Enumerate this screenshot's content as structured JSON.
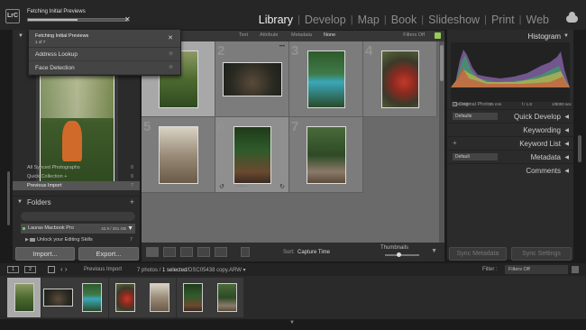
{
  "app": {
    "logo": "LrC"
  },
  "task": {
    "title": "Fetching Initial Previews",
    "progress": 0.5
  },
  "popup": {
    "title": "Fetching Initial Previews",
    "subtitle": "1 of 7",
    "items": [
      {
        "label": "Address Lookup"
      },
      {
        "label": "Face Detection"
      }
    ]
  },
  "modules": [
    "Library",
    "Develop",
    "Map",
    "Book",
    "Slideshow",
    "Print",
    "Web"
  ],
  "active_module": "Library",
  "filter_bar": {
    "text": "Text",
    "attribute": "Attribute",
    "metadata": "Metadata",
    "none": "None",
    "filters_off": "Filters Off"
  },
  "catalog": [
    {
      "label": "All Synced Photographs",
      "count": "0"
    },
    {
      "label": "Quick Collection +",
      "count": "0"
    },
    {
      "label": "Previous Import",
      "count": "7"
    }
  ],
  "folders": {
    "label": "Folders",
    "volume": {
      "name": "Lauras Macbook Pro",
      "size": "42.9 / 251 GB"
    },
    "folder": {
      "name": "Unlock your Editing Skills",
      "count": "7"
    }
  },
  "buttons": {
    "import": "Import...",
    "export": "Export...",
    "sync_metadata": "Sync Metadata",
    "sync_settings": "Sync Settings"
  },
  "grid": {
    "cells": [
      {
        "num": "1",
        "photo": "p1"
      },
      {
        "num": "2",
        "photo": "p2"
      },
      {
        "num": "3",
        "photo": "p3"
      },
      {
        "num": "4",
        "photo": "p4"
      },
      {
        "num": "5",
        "photo": "p5"
      },
      {
        "num": "6",
        "photo": "p6"
      },
      {
        "num": "7",
        "photo": "p7"
      }
    ],
    "selected_index": 0
  },
  "toolbar": {
    "sort_label": "Sort:",
    "sort_value": "Capture Time",
    "thumbnails_label": "Thumbnails"
  },
  "histogram": {
    "label": "Histogram",
    "iso": "ISO 800",
    "focal": "35 mm",
    "aperture": "f / 1.8",
    "shutter": "1/8000 sec",
    "original_photo": "Original Photo"
  },
  "right_panel": {
    "quick_develop": "Quick Develop",
    "quick_develop_preset": "Defaults",
    "keywording": "Keywording",
    "keyword_list": "Keyword List",
    "metadata": "Metadata",
    "metadata_preset": "Default",
    "comments": "Comments"
  },
  "filmstrip_bar": {
    "monitor1": "1",
    "monitor2": "2",
    "source": "Previous Import",
    "count_prefix": "7 photos /",
    "count_selected": "1 selected",
    "filename": "/DSC05438 copy.ARW",
    "filter_label": "Filter :",
    "filter_value": "Filters Off"
  },
  "filmstrip": [
    "p1",
    "p2",
    "p3",
    "p4",
    "p5",
    "p6",
    "p7"
  ],
  "colors": {
    "accent": "#9c5",
    "panel": "#2b2b2b",
    "grid": "#6a6a6a"
  }
}
